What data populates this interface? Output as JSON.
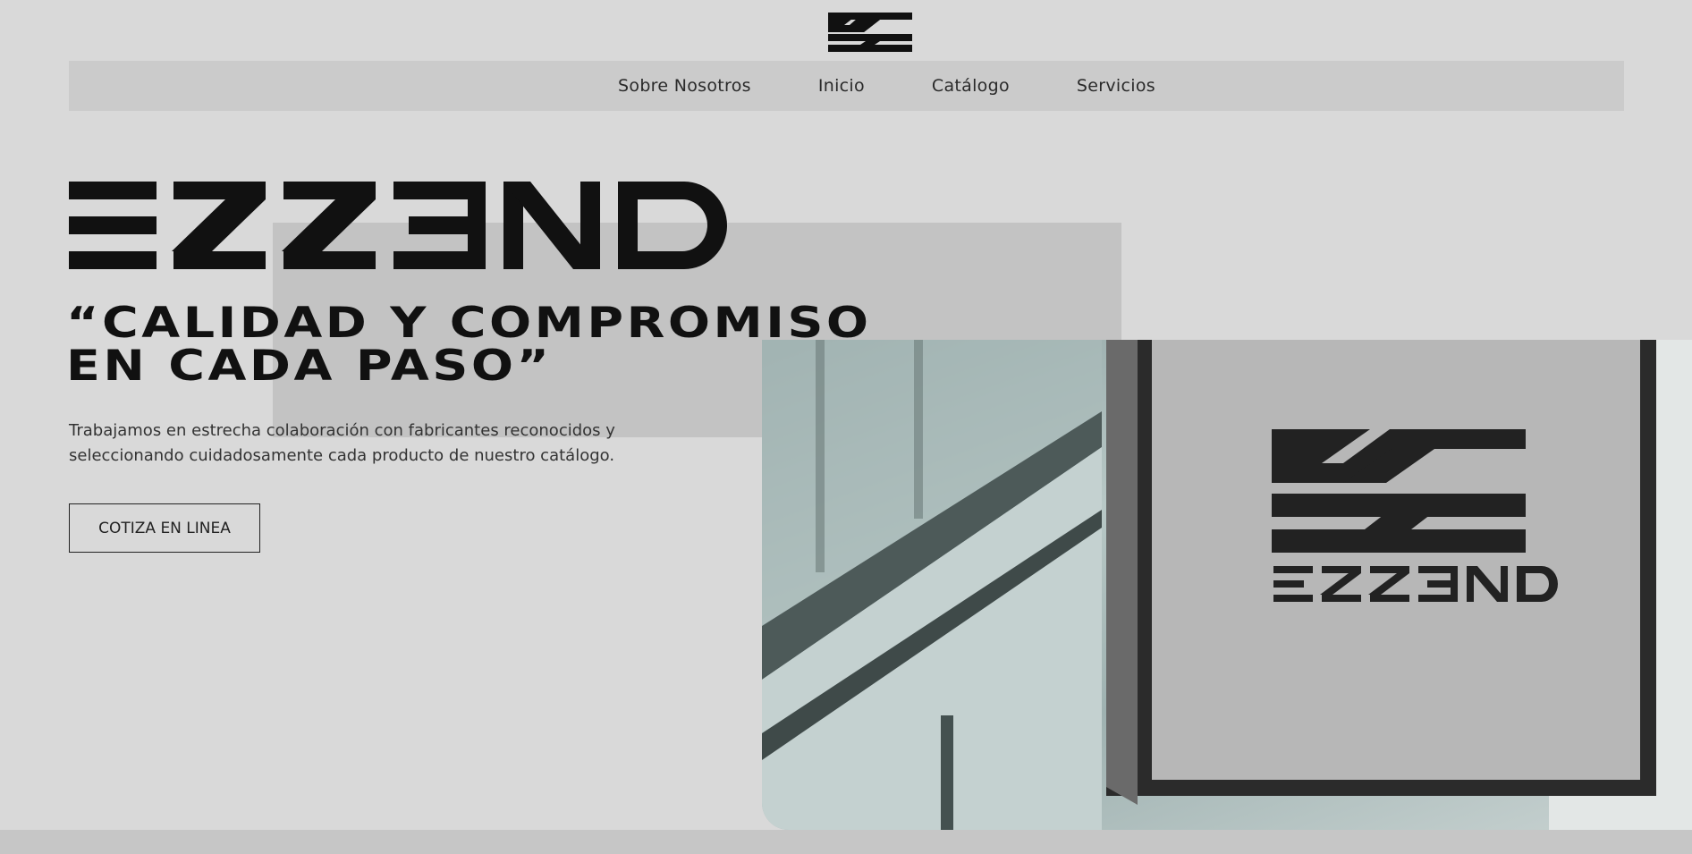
{
  "brand": {
    "logo_icon": "zs-monogram-icon",
    "wordmark": "ESZEND"
  },
  "nav": {
    "items": [
      {
        "label": "Sobre Nosotros"
      },
      {
        "label": "Inicio"
      },
      {
        "label": "Catálogo"
      },
      {
        "label": "Servicios"
      }
    ]
  },
  "hero": {
    "tagline": "“CALIDAD Y COMPROMISO\nEN CADA PASO”",
    "description": "Trabajamos en estrecha colaboración con fabricantes reconocidos y seleccionando cuidadosamente cada producto de nuestro catálogo.",
    "cta_label": "COTIZA EN LINEA"
  },
  "colors": {
    "background": "#d9d9d9",
    "nav_bar": "#cbcbcb",
    "text": "#111111"
  }
}
